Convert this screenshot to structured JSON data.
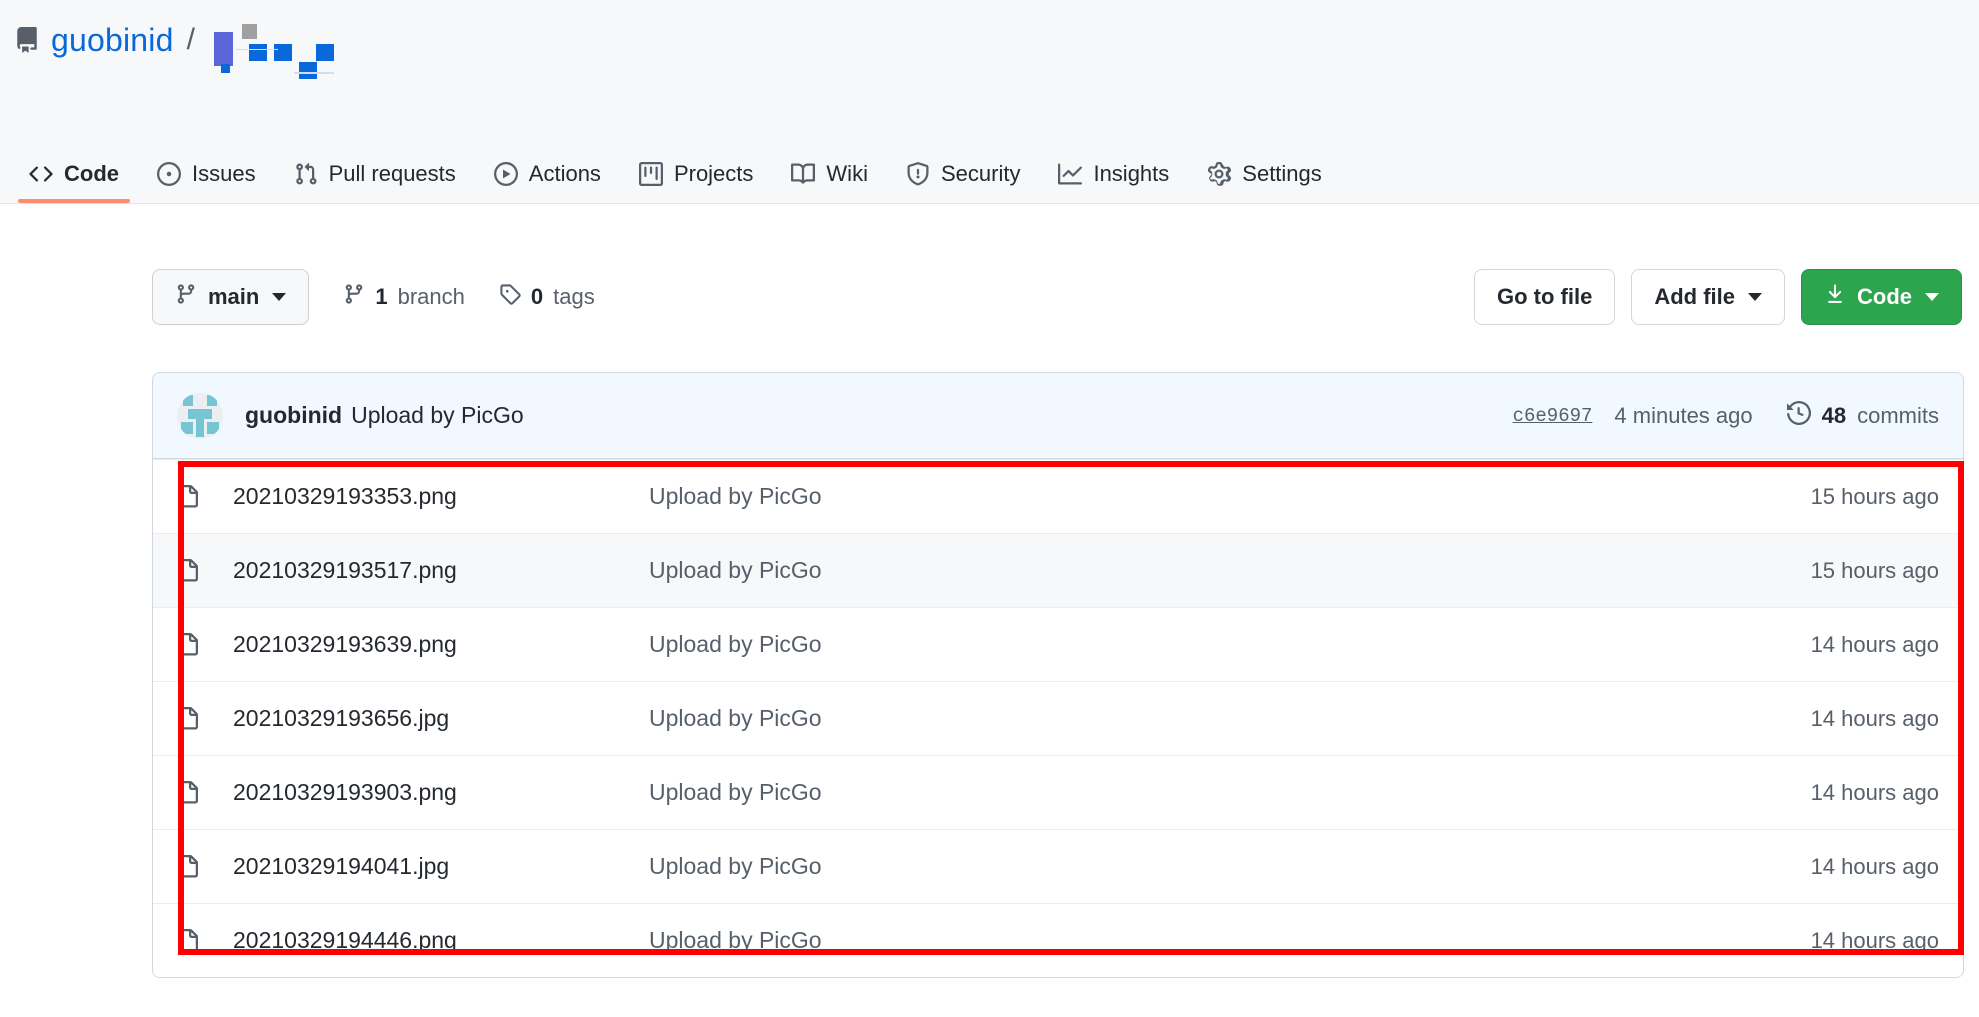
{
  "header": {
    "repo_icon": "repo-icon",
    "owner": "guobinid",
    "separator": "/",
    "repo_name_redacted": true
  },
  "nav": {
    "items": [
      {
        "label": "Code",
        "icon": "code-icon",
        "selected": true
      },
      {
        "label": "Issues",
        "icon": "issue-opened-icon",
        "selected": false
      },
      {
        "label": "Pull requests",
        "icon": "git-pull-request-icon",
        "selected": false
      },
      {
        "label": "Actions",
        "icon": "play-icon",
        "selected": false
      },
      {
        "label": "Projects",
        "icon": "project-icon",
        "selected": false
      },
      {
        "label": "Wiki",
        "icon": "book-icon",
        "selected": false
      },
      {
        "label": "Security",
        "icon": "shield-icon",
        "selected": false
      },
      {
        "label": "Insights",
        "icon": "graph-icon",
        "selected": false
      },
      {
        "label": "Settings",
        "icon": "gear-icon",
        "selected": false
      }
    ]
  },
  "toolbar": {
    "branch_name": "main",
    "branch_count_num": "1",
    "branch_count_label": "branch",
    "tag_count_num": "0",
    "tag_count_label": "tags",
    "go_to_file": "Go to file",
    "add_file": "Add file",
    "code": "Code",
    "code_button_color": "#2da44e"
  },
  "commit_bar": {
    "author": "guobinid",
    "message": "Upload by PicGo",
    "sha": "c6e9697",
    "time": "4 minutes ago",
    "commits_count": "48",
    "commits_label": "commits",
    "history_icon": "history-icon"
  },
  "files": {
    "rows": [
      {
        "name": "20210329193353.png",
        "message": "Upload by PicGo",
        "age": "15 hours ago",
        "icon": "file-icon",
        "alt": false
      },
      {
        "name": "20210329193517.png",
        "message": "Upload by PicGo",
        "age": "15 hours ago",
        "icon": "file-icon",
        "alt": true
      },
      {
        "name": "20210329193639.png",
        "message": "Upload by PicGo",
        "age": "14 hours ago",
        "icon": "file-icon",
        "alt": false
      },
      {
        "name": "20210329193656.jpg",
        "message": "Upload by PicGo",
        "age": "14 hours ago",
        "icon": "file-icon",
        "alt": false
      },
      {
        "name": "20210329193903.png",
        "message": "Upload by PicGo",
        "age": "14 hours ago",
        "icon": "file-icon",
        "alt": false
      },
      {
        "name": "20210329194041.jpg",
        "message": "Upload by PicGo",
        "age": "14 hours ago",
        "icon": "file-icon",
        "alt": false
      },
      {
        "name": "20210329194446.png",
        "message": "Upload by PicGo",
        "age": "14 hours ago",
        "icon": "file-icon",
        "alt": false
      }
    ]
  },
  "annotation": {
    "highlight_color": "#ff0000",
    "shape": "rectangle"
  }
}
